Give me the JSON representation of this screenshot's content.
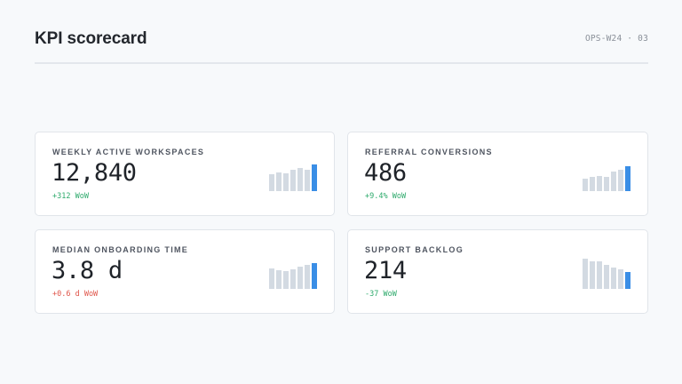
{
  "header": {
    "title": "KPI scorecard",
    "code": "OPS-W24 · 03"
  },
  "colors": {
    "positive": "#2eaa6c",
    "negative": "#e0564b",
    "bar": "#d3dae2",
    "bar_current": "#3a8ee6"
  },
  "cards": [
    {
      "label": "WEEKLY ACTIVE WORKSPACES",
      "value": "12,840",
      "delta": "+312 WoW",
      "delta_sentiment": "positive",
      "trend": [
        0.56,
        0.62,
        0.58,
        0.7,
        0.76,
        0.72,
        0.88
      ]
    },
    {
      "label": "REFERRAL CONVERSIONS",
      "value": "486",
      "delta": "+9.4% WoW",
      "delta_sentiment": "positive",
      "trend": [
        0.4,
        0.46,
        0.5,
        0.48,
        0.64,
        0.72,
        0.82
      ]
    },
    {
      "label": "MEDIAN ONBOARDING TIME",
      "value": "3.8 d",
      "delta": "+0.6 d WoW",
      "delta_sentiment": "negative",
      "trend": [
        0.68,
        0.62,
        0.6,
        0.66,
        0.74,
        0.8,
        0.86
      ]
    },
    {
      "label": "SUPPORT BACKLOG",
      "value": "214",
      "delta": "-37 WoW",
      "delta_sentiment": "positive",
      "trend": [
        1.0,
        0.9,
        0.92,
        0.78,
        0.72,
        0.64,
        0.56
      ]
    }
  ]
}
